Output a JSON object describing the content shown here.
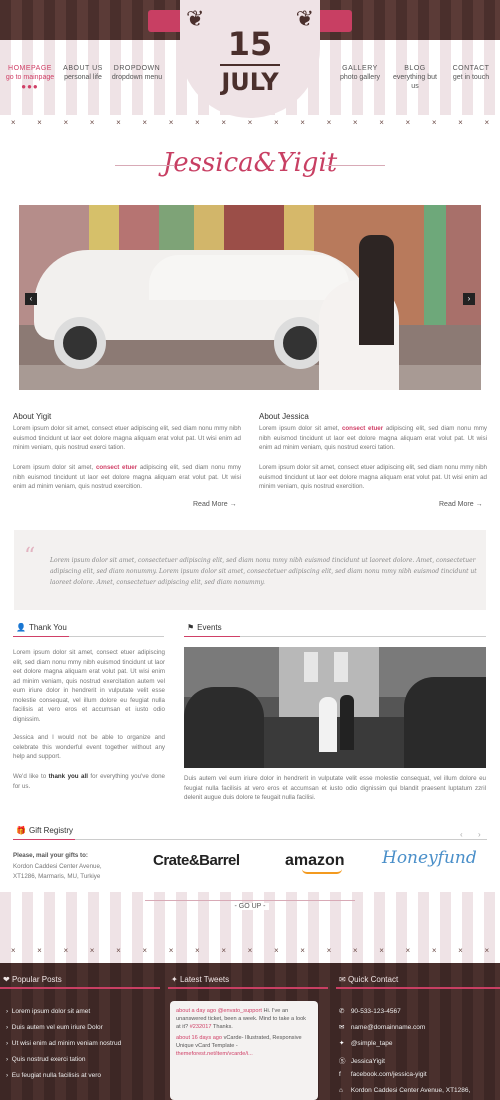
{
  "nav": {
    "left": [
      {
        "label": "HOMEPAGE",
        "sub": "go to mainpage",
        "active": true
      },
      {
        "label": "ABOUT US",
        "sub": "personal life",
        "active": false
      },
      {
        "label": "DROPDOWN",
        "sub": "dropdown menu",
        "active": false
      }
    ],
    "right": [
      {
        "label": "GALLERY",
        "sub": "photo gallery"
      },
      {
        "label": "BLOG",
        "sub": "everything but us"
      },
      {
        "label": "CONTACT",
        "sub": "get in touch"
      }
    ],
    "active_dots": "●●●"
  },
  "badge": {
    "day": "15",
    "month": "JULY"
  },
  "couple_title": "Jessica&Yigit",
  "slider": {
    "prev": "‹",
    "next": "›"
  },
  "about_yigit": {
    "title": "About Yigit",
    "p1": "Lorem ipsum dolor sit amet, consect etuer adipiscing elit, sed diam nonu mmy nibh euismod tincidunt ut laor eet dolore magna aliquam erat volut pat. Ut wisi enim ad minim veniam, quis nostrud exerci tation.",
    "p2_pre": "Lorem ipsum dolor sit amet, ",
    "p2_hl": "consect etuer",
    "p2_post": " adipiscing elit, sed diam nonu mmy nibh euismod tincidunt ut laor eet dolore magna aliquam erat volut pat. Ut wisi enim ad minim veniam, quis nostrud exercition.",
    "read_more": "Read More →"
  },
  "about_jessica": {
    "title": "About Jessica",
    "p1_pre": "Lorem ipsum dolor sit amet, ",
    "p1_hl": "consect etuer",
    "p1_post": " adipiscing elit, sed diam nonu mmy nibh euismod tincidunt ut laor eet dolore magna aliquam erat volut pat. Ut wisi enim ad minim veniam, quis nostrud exerci tation.",
    "p2": "Lorem ipsum dolor sit amet, consect etuer adipiscing elit, sed diam nonu mmy nibh euismod tincidunt ut laor eet dolore magna aliquam erat volut pat. Ut wisi enim ad minim veniam, quis nostrud exercition.",
    "read_more": "Read More →"
  },
  "quote": {
    "mark": "“",
    "text": "Lorem ipsum dolor sit amet, consectetuer adipiscing elit, sed diam nonu mmy nibh euismod tincidunt ut laoreet dolore. Amet, consectetuer adipiscing elit, sed diam nonummy. Lorem ipsum dolor sit amet, consectetuer adipiscing elit, sed diam nonu mmy nibh euismod tincidunt ut laoreet dolore. Amet, consectetuer adipiscing elit, sed diam nonummy."
  },
  "thank_you": {
    "title": "Thank You",
    "p1": "Lorem ipsum dolor sit amet, consect etuer adipiscing elit, sed diam nonu mmy nibh euismod tincidunt ut laor eet dolore magna aliquam erat volut pat. Ut wisi enim ad minim veniam, quis nostrud exercitation autem vel eum iriure dolor in hendrerit in vulputate velit esse molestie consequat, vel illum dolore eu feugiat nulla facilisis at vero eros et accumsan et iusto odio dignissim.",
    "p2": "Jessica and I would not be able to organize and celebrate this wonderful event together without any help and support.",
    "p3_pre": "We'd like to ",
    "p3_hl": "thank you all",
    "p3_post": " for everything you've done for us."
  },
  "events": {
    "title": "Events",
    "caption": "Duis autem vel eum iriure dolor in hendrerit in vulputate velit esse molestie consequat, vel illum dolore eu feugiat nulla facilisis at vero eros et accumsan et iusto odio dignissim qui blandit praesent luptatum zzril delenit augue duis dolore te feugait nulla facilisi."
  },
  "gift": {
    "title": "Gift Registry",
    "mail_label": "Please, mail your gifts to:",
    "address1": "Kordon Caddesi Center Avenue,",
    "address2": "XT1286, Marmaris, MU, Turkiye",
    "logos": [
      "Crate&Barrel",
      "amazon",
      "Honeyfund"
    ],
    "prev": "‹",
    "next": "›"
  },
  "go_up": "- GO UP -",
  "footer": {
    "popular_title": "Popular Posts",
    "popular": [
      "Lorem ipsum dolor sit amet",
      "Duis autem vel eum iriure Dolor",
      "Ut wisi enim ad minim veniam nostrud",
      "Quis nostrud exerci tation",
      "Eu feugiat nulla facilisis at vero"
    ],
    "tweets_title": "Latest Tweets",
    "tweet1_time": "about a day ago",
    "tweet1_user": "@envato_support",
    "tweet1_text": " Hi. I've an unanswered ticket, been a week. Mind to take a look at it? ",
    "tweet1_tag": "#232017",
    "tweet1_end": " Thanks.",
    "tweet2_time": "about 16 days ago",
    "tweet2_text": " vCarde- Illustrated, Responsive Unique vCard Template - ",
    "tweet2_link": "themeforest.net/item/vcarde/i...",
    "contact_title": "Quick Contact",
    "contact": [
      {
        "icon": "phone-icon",
        "glyph": "✆",
        "text": "90-533-123-4567"
      },
      {
        "icon": "mail-icon",
        "glyph": "✉",
        "text": "name@domainname.com"
      },
      {
        "icon": "twitter-icon",
        "glyph": "✦",
        "text": "@simple_tape"
      },
      {
        "icon": "skype-icon",
        "glyph": "Ⓢ",
        "text": "JessicaYigit"
      },
      {
        "icon": "facebook-icon",
        "glyph": "f",
        "text": "facebook.com/jessica-yigit"
      },
      {
        "icon": "location-icon",
        "glyph": "⌂",
        "text": "Kordon Caddesi Center Avenue, XT1286,"
      }
    ]
  },
  "colors": {
    "accent": "#d04067",
    "dark": "#4a2f2c",
    "stripe": "#efe3e6"
  }
}
